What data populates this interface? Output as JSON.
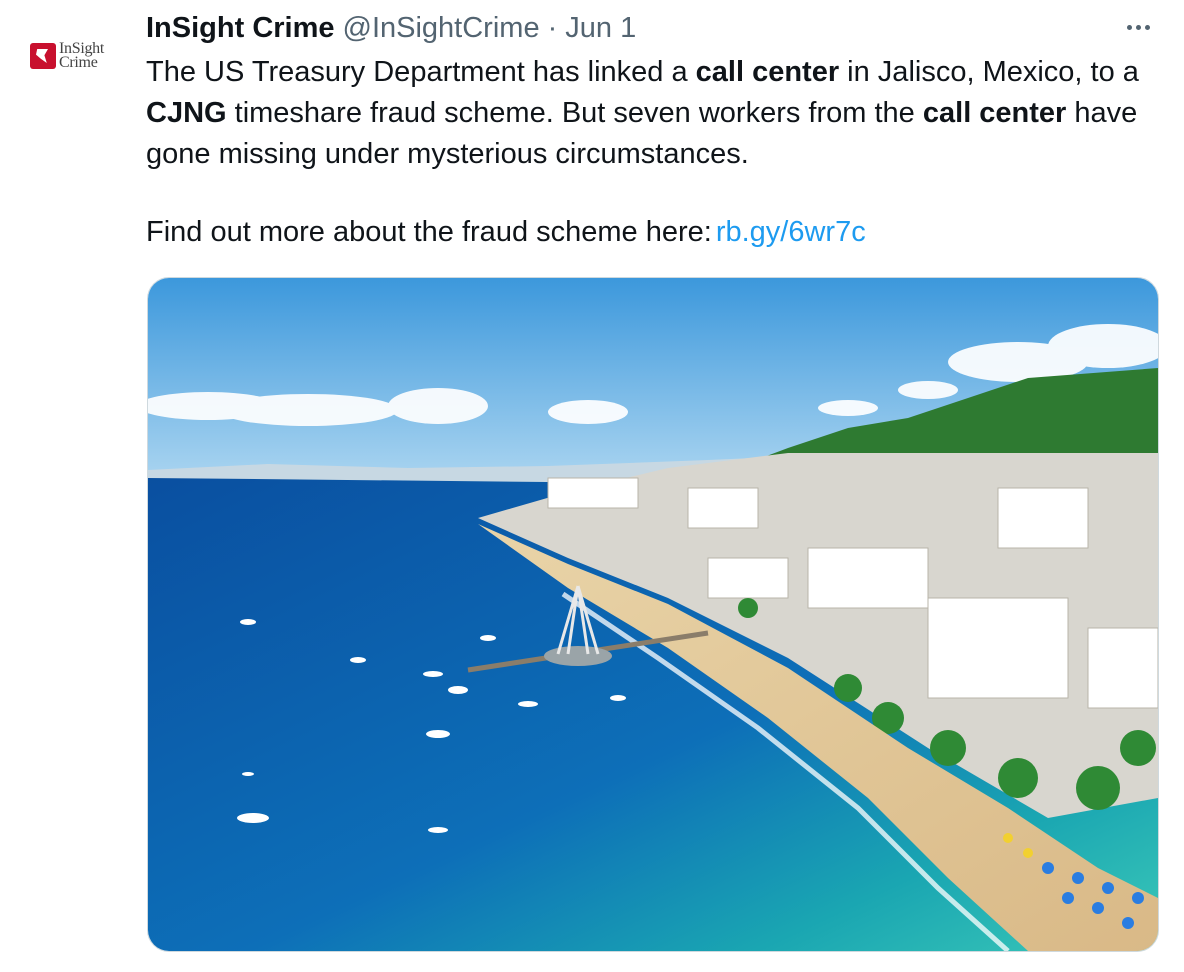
{
  "tweet": {
    "avatar_logo_line1": "InSight",
    "avatar_logo_line2": "Crime",
    "display_name": "InSight Crime",
    "handle": "@InSightCrime",
    "separator": "·",
    "date": "Jun 1",
    "more_icon": "more-horizontal-icon",
    "text": {
      "p1_a": "The US Treasury Department has linked a ",
      "p1_b": "call center",
      "p1_c": " in Jalisco, Mexico, to a ",
      "p1_d": "CJNG",
      "p1_e": " timeshare fraud scheme. But seven workers from the ",
      "p1_f": "call center",
      "p1_g": " have gone missing under mysterious circumstances.",
      "p2_text": "Find out more about the fraud scheme here:",
      "p2_link": "rb.gy/6wr7c"
    },
    "link_color": "#1d9bf0"
  },
  "media": {
    "description": "photo",
    "colors": {
      "sky": "#4aa3e0",
      "ocean_deep": "#0b56a8",
      "ocean_shallow": "#22b2b0",
      "beach": "#e7cfa3",
      "hills": "#2f7d32"
    }
  }
}
